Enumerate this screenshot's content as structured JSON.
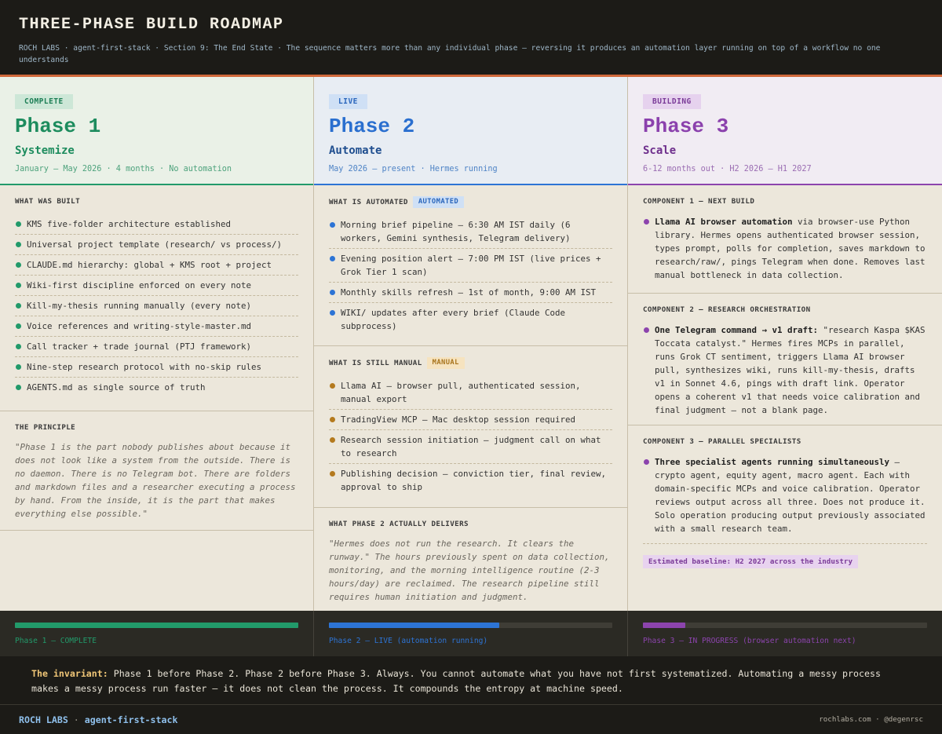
{
  "header": {
    "title": "THREE-PHASE BUILD ROADMAP",
    "subtitle": "ROCH LABS · agent-first-stack · Section 9: The End State · The sequence matters more than any individual phase — reversing it produces an automation layer running on top of a workflow no one understands"
  },
  "colors": {
    "phase1": "#229a6a",
    "phase2": "#2d74d5",
    "phase3": "#8c44ad",
    "accent": "#d0693b"
  },
  "phase1": {
    "badge": "COMPLETE",
    "title": "Phase 1",
    "name": "Systemize",
    "meta": "January — May 2026 · 4 months · No automation",
    "built_label": "WHAT WAS BUILT",
    "built": [
      "KMS five-folder architecture established",
      "Universal project template (research/ vs process/)",
      "CLAUDE.md hierarchy: global + KMS root + project",
      "Wiki-first discipline enforced on every note",
      "Kill-my-thesis running manually (every note)",
      "Voice references and writing-style-master.md",
      "Call tracker + trade journal (PTJ framework)",
      "Nine-step research protocol with no-skip rules",
      "AGENTS.md as single source of truth"
    ],
    "principle_label": "THE PRINCIPLE",
    "principle": "\"Phase 1 is the part nobody publishes about because it does not look like a system from the outside. There is no daemon. There is no Telegram bot. There are folders and markdown files and a researcher executing a process by hand. From the inside, it is the part that makes everything else possible.\""
  },
  "phase2": {
    "badge": "LIVE",
    "title": "Phase 2",
    "name": "Automate",
    "meta": "May 2026 — present · Hermes running",
    "automated_label": "WHAT IS AUTOMATED",
    "automated_tag": "AUTOMATED",
    "automated": [
      "Morning brief pipeline — 6:30 AM IST daily (6 workers, Gemini synthesis, Telegram delivery)",
      "Evening position alert — 7:00 PM IST (live prices + Grok Tier 1 scan)",
      "Monthly skills refresh — 1st of month, 9:00 AM IST",
      "WIKI/ updates after every brief (Claude Code subprocess)"
    ],
    "manual_label": "WHAT IS STILL MANUAL",
    "manual_tag": "MANUAL",
    "manual": [
      "Llama AI — browser pull, authenticated session, manual export",
      "TradingView MCP — Mac desktop session required",
      "Research session initiation — judgment call on what to research",
      "Publishing decision — conviction tier, final review, approval to ship"
    ],
    "delivers_label": "WHAT PHASE 2 ACTUALLY DELIVERS",
    "delivers": "\"Hermes does not run the research. It clears the runway.\" The hours previously spent on data collection, monitoring, and the morning intelligence routine (2-3 hours/day) are reclaimed. The research pipeline still requires human initiation and judgment."
  },
  "phase3": {
    "badge": "BUILDING",
    "title": "Phase 3",
    "name": "Scale",
    "meta": "6-12 months out · H2 2026 — H1 2027",
    "c1_label": "COMPONENT 1 — NEXT BUILD",
    "c1_bold": "Llama AI browser automation",
    "c1_text": " via browser-use Python library. Hermes opens authenticated browser session, types prompt, polls for completion, saves markdown to research/raw/, pings Telegram when done. Removes last manual bottleneck in data collection.",
    "c2_label": "COMPONENT 2 — RESEARCH ORCHESTRATION",
    "c2_bold": "One Telegram command → v1 draft:",
    "c2_text": " \"research Kaspa $KAS Toccata catalyst.\" Hermes fires MCPs in parallel, runs Grok CT sentiment, triggers Llama AI browser pull, synthesizes wiki, runs kill-my-thesis, drafts v1 in Sonnet 4.6, pings with draft link. Operator opens a coherent v1 that needs voice calibration and final judgment — not a blank page.",
    "c3_label": "COMPONENT 3 — PARALLEL SPECIALISTS",
    "c3_bold": "Three specialist agents running simultaneously",
    "c3_text": " — crypto agent, equity agent, macro agent. Each with domain-specific MCPs and voice calibration. Operator reviews output across all three. Does not produce it. Solo operation producing output previously associated with a small research team.",
    "baseline": "Estimated baseline: H2 2027 across the industry"
  },
  "progress": [
    {
      "label": "Phase 1 — COMPLETE",
      "percent": 100,
      "color": "#229a6a"
    },
    {
      "label": "Phase 2 — LIVE (automation running)",
      "percent": 60,
      "color": "#2d74d5"
    },
    {
      "label": "Phase 3 — IN PROGRESS (browser automation next)",
      "percent": 15,
      "color": "#8c44ad"
    }
  ],
  "invariant": {
    "lead": "The invariant:",
    "text": " Phase 1 before Phase 2. Phase 2 before Phase 3. Always. You cannot automate what you have not first systematized. Automating a messy process makes a messy process run faster — it does not clean the process. It compounds the entropy at machine speed."
  },
  "footer": {
    "brand": "ROCH LABS",
    "sep": " · ",
    "project": "agent-first-stack",
    "links": "rochlabs.com · @degenrsc"
  }
}
